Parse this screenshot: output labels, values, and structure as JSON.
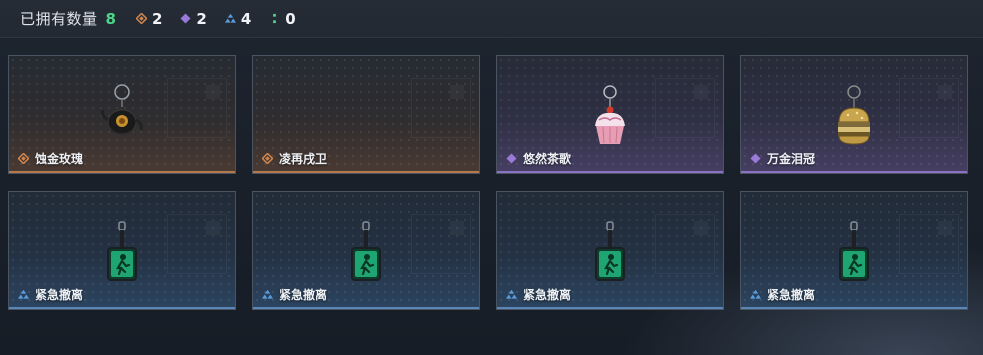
{
  "header": {
    "owned_label": "已拥有数量",
    "owned_count": "8",
    "stats": [
      {
        "icon": "orange-diamond-rarity-icon",
        "value": "2",
        "color": "#d1874f"
      },
      {
        "icon": "purple-diamond-rarity-icon",
        "value": "2",
        "color": "#9a7ad8"
      },
      {
        "icon": "blue-triangle-rarity-icon",
        "value": "4",
        "color": "#5a9de0"
      },
      {
        "icon": "green-dots-rarity-icon",
        "value": "0",
        "color": "#4fd58a"
      }
    ]
  },
  "items": [
    {
      "name": "蚀金玫瑰",
      "tier": "orange",
      "art": "black-rose-teapot-charm-icon"
    },
    {
      "name": "凌再戌卫",
      "tier": "orange",
      "art": "empty"
    },
    {
      "name": "悠然茶歌",
      "tier": "purple",
      "art": "cupcake-charm-icon"
    },
    {
      "name": "万金泪冠",
      "tier": "purple",
      "art": "gold-burger-charm-icon"
    },
    {
      "name": "紧急撤离",
      "tier": "blue",
      "art": "green-exit-sign-charm-icon"
    },
    {
      "name": "紧急撤离",
      "tier": "blue",
      "art": "green-exit-sign-charm-icon"
    },
    {
      "name": "紧急撤离",
      "tier": "blue",
      "art": "green-exit-sign-charm-icon"
    },
    {
      "name": "紧急撤离",
      "tier": "blue",
      "art": "green-exit-sign-charm-icon"
    }
  ],
  "colors": {
    "orange": "#d1874f",
    "purple": "#9a7ad8",
    "blue": "#5a9de0",
    "green_count": "#4fd58a"
  }
}
